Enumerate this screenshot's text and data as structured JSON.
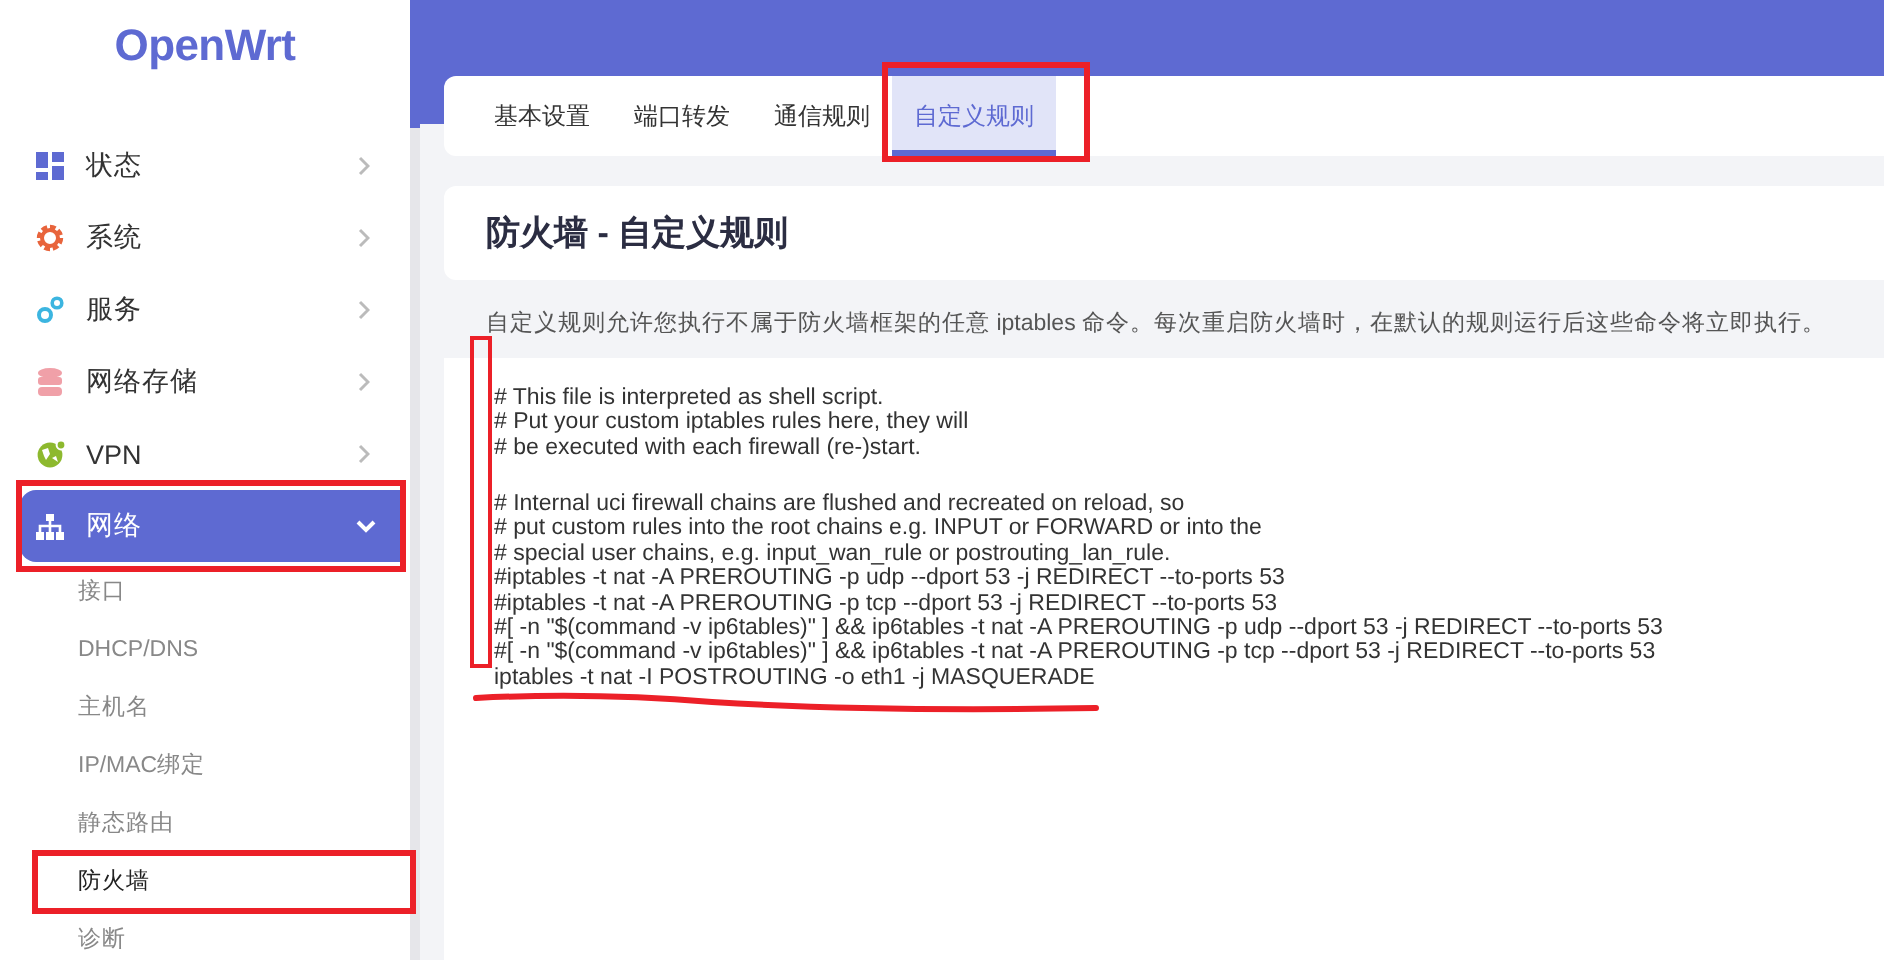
{
  "logo": "OpenWrt",
  "sidebar": {
    "items": [
      {
        "label": "状态",
        "kind": "dashboard",
        "expanded": false,
        "highlighted": false
      },
      {
        "label": "系统",
        "kind": "gear",
        "expanded": false,
        "highlighted": false
      },
      {
        "label": "服务",
        "kind": "gears",
        "expanded": false,
        "highlighted": false
      },
      {
        "label": "网络存储",
        "kind": "storage",
        "expanded": false,
        "highlighted": false
      },
      {
        "label": "VPN",
        "kind": "globe",
        "expanded": false,
        "highlighted": false
      },
      {
        "label": "网络",
        "kind": "network",
        "expanded": true,
        "highlighted": true,
        "children": [
          {
            "label": "接口",
            "selected": false,
            "highlighted": false
          },
          {
            "label": "DHCP/DNS",
            "selected": false,
            "highlighted": false
          },
          {
            "label": "主机名",
            "selected": false,
            "highlighted": false
          },
          {
            "label": "IP/MAC绑定",
            "selected": false,
            "highlighted": false
          },
          {
            "label": "静态路由",
            "selected": false,
            "highlighted": false
          },
          {
            "label": "防火墙",
            "selected": true,
            "highlighted": true
          },
          {
            "label": "诊断",
            "selected": false,
            "highlighted": false
          }
        ]
      }
    ]
  },
  "tabs": [
    {
      "label": "基本设置",
      "selected": false,
      "highlighted": false
    },
    {
      "label": "端口转发",
      "selected": false,
      "highlighted": false
    },
    {
      "label": "通信规则",
      "selected": false,
      "highlighted": false
    },
    {
      "label": "自定义规则",
      "selected": true,
      "highlighted": true
    }
  ],
  "page": {
    "title": "防火墙 - 自定义规则",
    "description": "自定义规则允许您执行不属于防火墙框架的任意 iptables 命令。每次重启防火墙时，在默认的规则运行后这些命令将立即执行。"
  },
  "editor": {
    "margin_marked": true,
    "lines": [
      {
        "kind": "text",
        "text": "# This file is interpreted as shell script.",
        "underlined": false
      },
      {
        "kind": "text",
        "text": "# Put your custom iptables rules here, they will",
        "underlined": false
      },
      {
        "kind": "text",
        "text": "# be executed with each firewall (re-)start.",
        "underlined": false
      },
      {
        "kind": "blank"
      },
      {
        "kind": "text",
        "text": "# Internal uci firewall chains are flushed and recreated on reload, so",
        "underlined": false
      },
      {
        "kind": "text",
        "text": "# put custom rules into the root chains e.g. INPUT or FORWARD or into the",
        "underlined": false
      },
      {
        "kind": "text",
        "text": "# special user chains, e.g. input_wan_rule or postrouting_lan_rule.",
        "underlined": false
      },
      {
        "kind": "text",
        "text": "#iptables -t nat -A PREROUTING -p udp --dport 53 -j REDIRECT --to-ports 53",
        "underlined": false
      },
      {
        "kind": "text",
        "text": "#iptables -t nat -A PREROUTING -p tcp --dport 53 -j REDIRECT --to-ports 53",
        "underlined": false
      },
      {
        "kind": "text",
        "text": "#[ -n \"$(command -v ip6tables)\" ] && ip6tables -t nat -A PREROUTING -p udp --dport 53 -j REDIRECT --to-ports 53",
        "underlined": false
      },
      {
        "kind": "text",
        "text": "#[ -n \"$(command -v ip6tables)\" ] && ip6tables -t nat -A PREROUTING -p tcp --dport 53 -j REDIRECT --to-ports 53",
        "underlined": false
      },
      {
        "kind": "text",
        "text": "iptables -t nat -I POSTROUTING -o eth1 -j MASQUERADE",
        "underlined": true
      }
    ]
  }
}
